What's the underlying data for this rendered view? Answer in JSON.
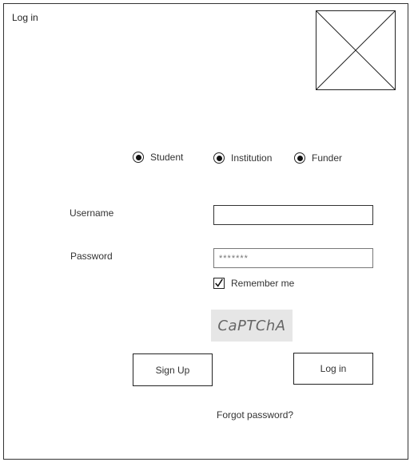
{
  "window": {
    "title": "Log in"
  },
  "account_types": [
    {
      "label": "Student",
      "selected": true
    },
    {
      "label": "Institution",
      "selected": true
    },
    {
      "label": "Funder",
      "selected": true
    }
  ],
  "form": {
    "username_label": "Username",
    "username_value": "",
    "password_label": "Password",
    "password_value": "*******",
    "remember_label": "Remember me",
    "remember_checked": true,
    "captcha_text": "CaPTChA"
  },
  "actions": {
    "signup_label": "Sign Up",
    "login_label": "Log in",
    "forgot_label": "Forgot password?"
  }
}
